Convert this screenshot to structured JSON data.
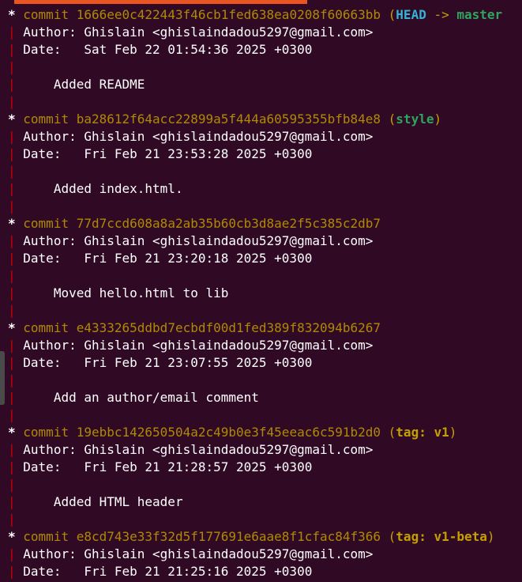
{
  "terminal": {
    "commits": [
      {
        "graph": "*",
        "label": "commit",
        "hash": "1666ee0c422443f46cb1fed638ea0208f60663bb",
        "refs_open": " (",
        "head": "HEAD",
        "arrow": " -> ",
        "branch": "master",
        "refs_close": "",
        "author": "Author: Ghislain <ghislaindadou5297@gmail.com>",
        "date": "Date:   Sat Feb 22 01:54:36 2025 +0300",
        "message": "    Added README"
      },
      {
        "graph": "*",
        "label": "commit",
        "hash": "ba28612f64acc22899a5f444a60595355bfb84e8",
        "refs_open": " (",
        "branch": "style",
        "refs_close": ")",
        "author": "Author: Ghislain <ghislaindadou5297@gmail.com>",
        "date": "Date:   Fri Feb 21 23:53:28 2025 +0300",
        "message": "    Added index.html."
      },
      {
        "graph": "*",
        "label": "commit",
        "hash": "77d7ccd608a8a2ab35b60cb3d8ae2f5c385c2db7",
        "author": "Author: Ghislain <ghislaindadou5297@gmail.com>",
        "date": "Date:   Fri Feb 21 23:20:18 2025 +0300",
        "message": "    Moved hello.html to lib"
      },
      {
        "graph": "*",
        "label": "commit",
        "hash": "e4333265ddbd7ecbdf00d1fed389f832094b6267",
        "author": "Author: Ghislain <ghislaindadou5297@gmail.com>",
        "date": "Date:   Fri Feb 21 23:07:55 2025 +0300",
        "message": "    Add an author/email comment"
      },
      {
        "graph": "*",
        "label": "commit",
        "hash": "19ebbc142650504a2c49b0e3f45eeac6c591b2d0",
        "refs_open": " (",
        "tag": "tag: v1",
        "refs_close": ")",
        "author": "Author: Ghislain <ghislaindadou5297@gmail.com>",
        "date": "Date:   Fri Feb 21 21:28:57 2025 +0300",
        "message": "    Added HTML header"
      },
      {
        "graph": "*",
        "label": "commit",
        "hash": "e8cd743e33f32d5f177691e6aae8f1cfac84f366",
        "refs_open": " (",
        "tag": "tag: v1-beta",
        "refs_close": ")",
        "author": "Author: Ghislain <ghislaindadou5297@gmail.com>",
        "date": "Date:   Fri Feb 21 21:25:16 2025 +0300"
      }
    ],
    "graph_bar": "|",
    "colors": {
      "background": "#300a24",
      "accent": "#e95420",
      "hash": "#c4a000",
      "head": "#34b3d9",
      "branch": "#2fa45e",
      "graph_bar": "#cc0000"
    }
  }
}
